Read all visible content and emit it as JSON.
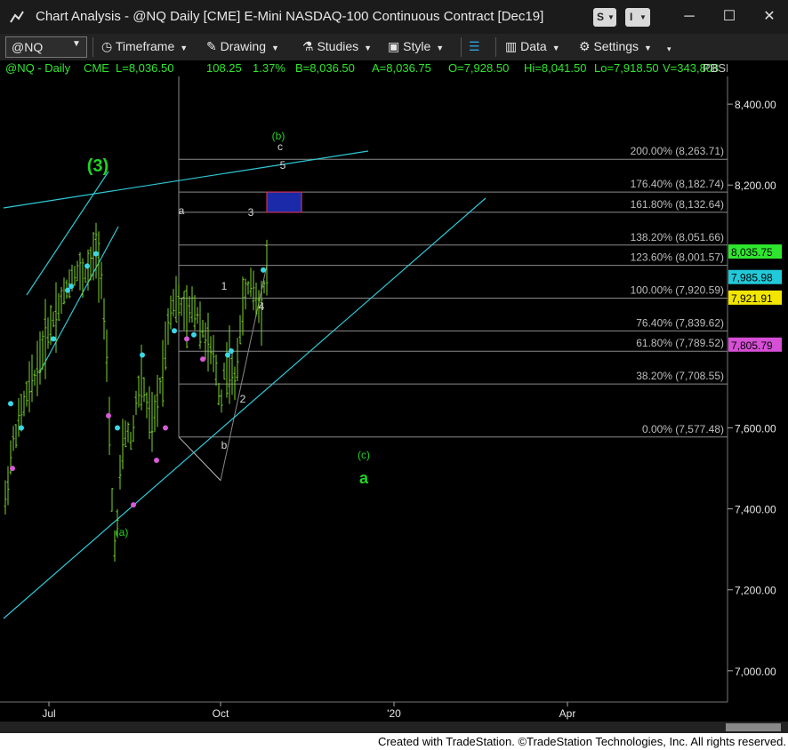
{
  "window": {
    "title": "Chart Analysis - @NQ Daily [CME] E-Mini NASDAQ-100 Continuous Contract [Dec19]",
    "s_button": "S",
    "i_button": "I"
  },
  "toolbar": {
    "symbol": "@NQ",
    "timeframe": "Timeframe",
    "drawing": "Drawing",
    "studies": "Studies",
    "style": "Style",
    "data": "Data",
    "settings": "Settings"
  },
  "infobar": {
    "symbol": "@NQ - Daily",
    "exchange": "CME",
    "last": "L=8,036.50",
    "change": "108.25",
    "pct": "1.37%",
    "bid": "B=8,036.50",
    "ask": "A=8,036.75",
    "open": "O=7,928.50",
    "high": "Hi=8,041.50",
    "low": "Lo=7,918.50",
    "volume": "V=343,808",
    "extra": "PBSI"
  },
  "footer": "Created with TradeStation. ©TradeStation Technologies, Inc. All rights reserved.",
  "colors": {
    "bars": "#7dd32a",
    "fib": "#8a8a8a",
    "trend": "#2fc9d6",
    "green_label": "#21d321",
    "white_label": "#d8d8d8"
  },
  "chart_data": {
    "type": "ohlc",
    "ylim": [
      6880,
      8430
    ],
    "y_ticks": [
      {
        "value": 8400,
        "label": "8,400.00"
      },
      {
        "value": 8200,
        "label": "8,200.00"
      },
      {
        "value": 7600,
        "label": "7,600.00"
      },
      {
        "value": 7400,
        "label": "7,400.00"
      },
      {
        "value": 7200,
        "label": "7,200.00"
      },
      {
        "value": 7000,
        "label": "7,000.00"
      }
    ],
    "x_ticks": [
      "Jul",
      "Oct",
      "'20",
      "Apr"
    ],
    "price_tags": [
      {
        "value": 8035.75,
        "label": "8,035.75",
        "bg": "#2ee62e",
        "fg": "#000"
      },
      {
        "value": 7985.98,
        "label": "7,985.98",
        "bg": "#21c9d9",
        "fg": "#000"
      },
      {
        "value": 7921.91,
        "label": "7,921.91",
        "bg": "#f2e600",
        "fg": "#000"
      },
      {
        "value": 7805.79,
        "label": "7,805.79",
        "bg": "#d64fd6",
        "fg": "#000"
      }
    ],
    "fib_levels": [
      {
        "pct": "200.00%",
        "value": 8263.71
      },
      {
        "pct": "176.40%",
        "value": 8182.74
      },
      {
        "pct": "161.80%",
        "value": 8132.64
      },
      {
        "pct": "138.20%",
        "value": 8051.66
      },
      {
        "pct": "123.60%",
        "value": 8001.57
      },
      {
        "pct": "100.00%",
        "value": 7920.59
      },
      {
        "pct": "76.40%",
        "value": 7839.62
      },
      {
        "pct": "61.80%",
        "value": 7789.52
      },
      {
        "pct": "38.20%",
        "value": 7708.55
      },
      {
        "pct": "0.00%",
        "value": 7577.48
      }
    ],
    "wave_labels": [
      {
        "text": "(3)",
        "color": "green",
        "size": 20,
        "bold": true
      },
      {
        "text": "(a)",
        "color": "green",
        "size": 12
      },
      {
        "text": "a",
        "color": "white",
        "size": 12
      },
      {
        "text": "b",
        "color": "white",
        "size": 12
      },
      {
        "text": "(b)",
        "color": "green",
        "size": 12
      },
      {
        "text": "c",
        "color": "white",
        "size": 12
      },
      {
        "text": "5",
        "color": "white",
        "size": 12
      },
      {
        "text": "1",
        "color": "white",
        "size": 12
      },
      {
        "text": "2",
        "color": "white",
        "size": 12
      },
      {
        "text": "3",
        "color": "white",
        "size": 12
      },
      {
        "text": "4",
        "color": "white",
        "size": 12
      },
      {
        "text": "(c)",
        "color": "green",
        "size": 12
      },
      {
        "text": "a",
        "color": "green",
        "size": 18,
        "bold": true
      }
    ],
    "target_box": {
      "low": 8132.64,
      "high": 8182.74
    },
    "approx_bar_range": {
      "low": 7230,
      "high": 8080
    }
  }
}
